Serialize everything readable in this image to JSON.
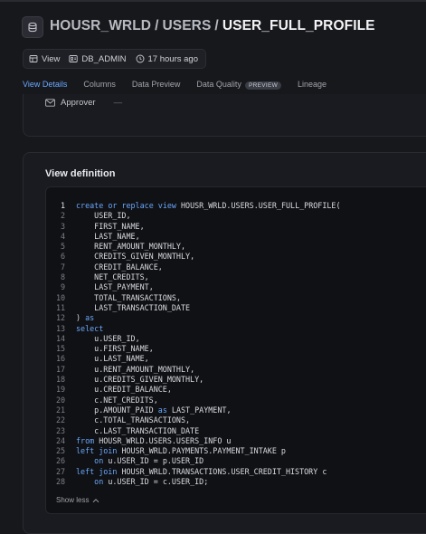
{
  "breadcrumb": {
    "db": "HOUSR_WRLD",
    "separator": "/",
    "schema": "USERS",
    "object": "USER_FULL_PROFILE"
  },
  "meta": {
    "type": "View",
    "owner": "DB_ADMIN",
    "updated": "17 hours ago"
  },
  "tabs": [
    {
      "label": "View Details",
      "active": true
    },
    {
      "label": "Columns"
    },
    {
      "label": "Data Preview"
    },
    {
      "label": "Data Quality",
      "badge": "PREVIEW"
    },
    {
      "label": "Lineage"
    }
  ],
  "approver": {
    "label": "Approver",
    "value": "—"
  },
  "definition": {
    "title": "View definition",
    "lines": [
      [
        "create or replace view HOUSR_WRLD.USERS.USER_FULL_PROFILE("
      ],
      [
        "    USER_ID,"
      ],
      [
        "    FIRST_NAME,"
      ],
      [
        "    LAST_NAME,"
      ],
      [
        "    RENT_AMOUNT_MONTHLY,"
      ],
      [
        "    CREDITS_GIVEN_MONTHLY,"
      ],
      [
        "    CREDIT_BALANCE,"
      ],
      [
        "    NET_CREDITS,"
      ],
      [
        "    LAST_PAYMENT,"
      ],
      [
        "    TOTAL_TRANSACTIONS,"
      ],
      [
        "    LAST_TRANSACTION_DATE"
      ],
      [
        ") as"
      ],
      [
        "select"
      ],
      [
        "    u.USER_ID,"
      ],
      [
        "    u.FIRST_NAME,"
      ],
      [
        "    u.LAST_NAME,"
      ],
      [
        "    u.RENT_AMOUNT_MONTHLY,"
      ],
      [
        "    u.CREDITS_GIVEN_MONTHLY,"
      ],
      [
        "    u.CREDIT_BALANCE,"
      ],
      [
        "    c.NET_CREDITS,"
      ],
      [
        "    p.AMOUNT_PAID as LAST_PAYMENT,"
      ],
      [
        "    c.TOTAL_TRANSACTIONS,"
      ],
      [
        "    c.LAST_TRANSACTION_DATE"
      ],
      [
        "from HOUSR_WRLD.USERS.USERS_INFO u"
      ],
      [
        "left join HOUSR_WRLD.PAYMENTS.PAYMENT_INTAKE p"
      ],
      [
        "    on u.USER_ID = p.USER_ID"
      ],
      [
        "left join HOUSR_WRLD.TRANSACTIONS.USER_CREDIT_HISTORY c"
      ],
      [
        "    on u.USER_ID = c.USER_ID;"
      ]
    ],
    "keywords": [
      "create",
      "or",
      "replace",
      "view",
      "as",
      "select",
      "from",
      "left",
      "join",
      "on"
    ],
    "show_less_label": "Show less"
  },
  "colors": {
    "accent": "#4d8ff7",
    "keyword": "#6aa8ff",
    "background": "#17181c"
  }
}
